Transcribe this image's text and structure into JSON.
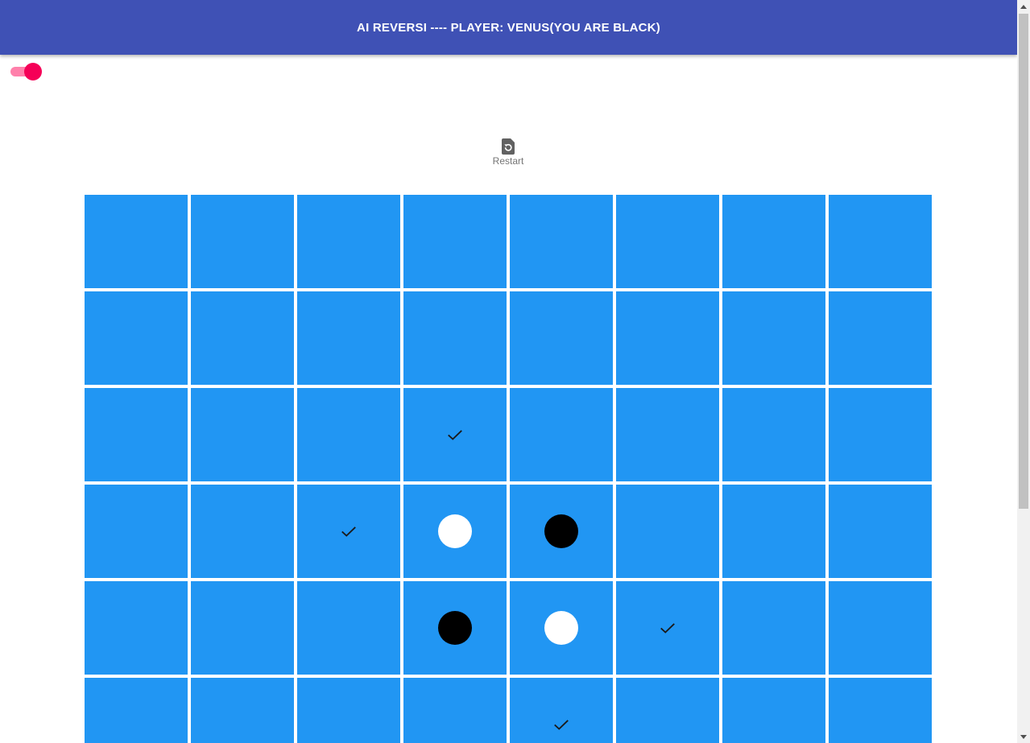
{
  "header": {
    "title": "AI REVERSI ---- PLAYER: VENUS(YOU ARE BLACK)"
  },
  "toggle": {
    "state": "on",
    "accent_color": "#f50057",
    "track_color": "#ff80ab"
  },
  "toolbar": {
    "restart_label": "Restart",
    "restart_icon": "restart-icon"
  },
  "colors": {
    "app_bar": "#3f51b5",
    "board_cell": "#2196f3",
    "grid_line": "#ffffff"
  },
  "board": {
    "rows": [
      [
        "empty",
        "empty",
        "empty",
        "empty",
        "empty",
        "empty",
        "empty",
        "empty"
      ],
      [
        "empty",
        "empty",
        "empty",
        "empty",
        "empty",
        "empty",
        "empty",
        "empty"
      ],
      [
        "empty",
        "empty",
        "empty",
        "hint",
        "empty",
        "empty",
        "empty",
        "empty"
      ],
      [
        "empty",
        "empty",
        "hint",
        "white",
        "black",
        "empty",
        "empty",
        "empty"
      ],
      [
        "empty",
        "empty",
        "empty",
        "black",
        "white",
        "hint",
        "empty",
        "empty"
      ],
      [
        "empty",
        "empty",
        "empty",
        "empty",
        "hint",
        "empty",
        "empty",
        "empty"
      ]
    ]
  }
}
